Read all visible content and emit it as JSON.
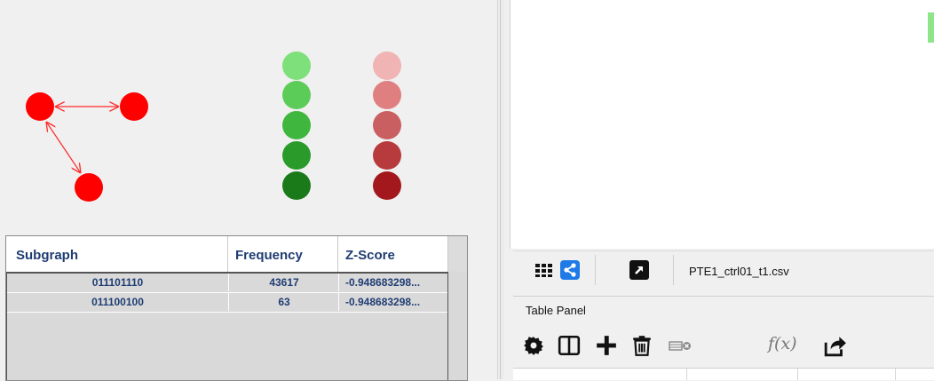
{
  "colors": {
    "node_red": "#ff0000",
    "edge_red": "#ff2a2a",
    "greens": [
      "#7ee07a",
      "#5ccc58",
      "#3fb63d",
      "#2a9a2a",
      "#1a7a1a"
    ],
    "reds": [
      "#f0b4b4",
      "#e07f80",
      "#c95f60",
      "#b73a3c",
      "#a2181c"
    ],
    "header_text": "#1f3d73",
    "accent_blue": "#1e7ae6"
  },
  "stats_table": {
    "headers": [
      "Subgraph",
      "Frequency",
      "Z-Score"
    ],
    "rows": [
      {
        "subgraph": "011101110",
        "frequency": "43617",
        "zscore": "-0.948683298..."
      },
      {
        "subgraph": "011100100",
        "frequency": "63",
        "zscore": "-0.948683298..."
      }
    ]
  },
  "view_toolbar": {
    "icons": [
      "grid-icon",
      "share-network-icon",
      "external-link-icon"
    ],
    "file_name": "PTE1_ctrl01_t1.csv"
  },
  "table_panel": {
    "title": "Table Panel",
    "icons": [
      "gear-icon",
      "split-columns-icon",
      "plus-icon",
      "trash-icon",
      "clear-column-icon",
      "function-icon",
      "export-icon"
    ],
    "function_label": "f(x)"
  }
}
